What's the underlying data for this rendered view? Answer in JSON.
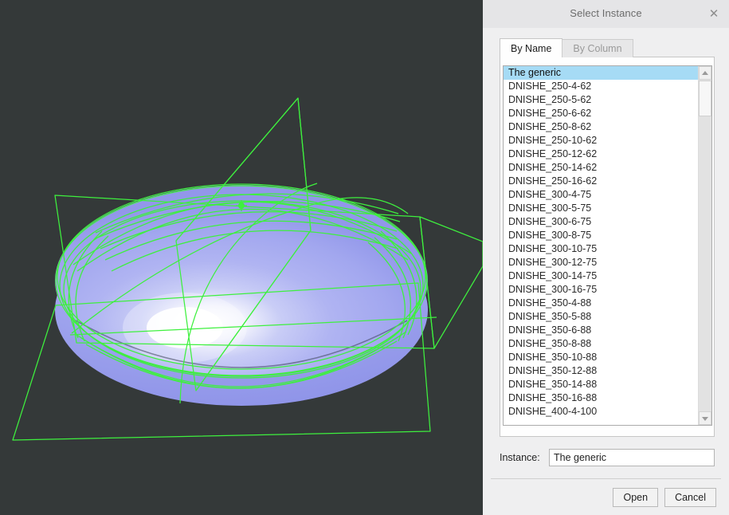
{
  "viewport": {
    "name": "cad-3d-viewport",
    "background_color": "#343939",
    "model_color": "#a3a8f0",
    "wireframe_color": "#3ef03e",
    "model_description": "Shaded ellipsoidal dished head with green construction wireframe"
  },
  "dialog": {
    "title": "Select Instance",
    "close_icon": "close-icon",
    "titlebar_color": "#e5e5e7",
    "body_color": "#efeff0",
    "tabs": [
      {
        "label": "By Name",
        "active": true
      },
      {
        "label": "By Column",
        "active": false
      }
    ],
    "list": {
      "selected_index": 0,
      "selection_color": "#a6dbf5",
      "items": [
        "The generic",
        "DNISHE_250-4-62",
        "DNISHE_250-5-62",
        "DNISHE_250-6-62",
        "DNISHE_250-8-62",
        "DNISHE_250-10-62",
        "DNISHE_250-12-62",
        "DNISHE_250-14-62",
        "DNISHE_250-16-62",
        "DNISHE_300-4-75",
        "DNISHE_300-5-75",
        "DNISHE_300-6-75",
        "DNISHE_300-8-75",
        "DNISHE_300-10-75",
        "DNISHE_300-12-75",
        "DNISHE_300-14-75",
        "DNISHE_300-16-75",
        "DNISHE_350-4-88",
        "DNISHE_350-5-88",
        "DNISHE_350-6-88",
        "DNISHE_350-8-88",
        "DNISHE_350-10-88",
        "DNISHE_350-12-88",
        "DNISHE_350-14-88",
        "DNISHE_350-16-88",
        "DNISHE_400-4-100"
      ],
      "scrollbar": {
        "up_arrow_icon": "chevron-up-icon",
        "down_arrow_icon": "chevron-down-icon"
      }
    },
    "instance": {
      "label": "Instance:",
      "value": "The generic",
      "placeholder": ""
    },
    "buttons": {
      "open": "Open",
      "cancel": "Cancel"
    }
  }
}
